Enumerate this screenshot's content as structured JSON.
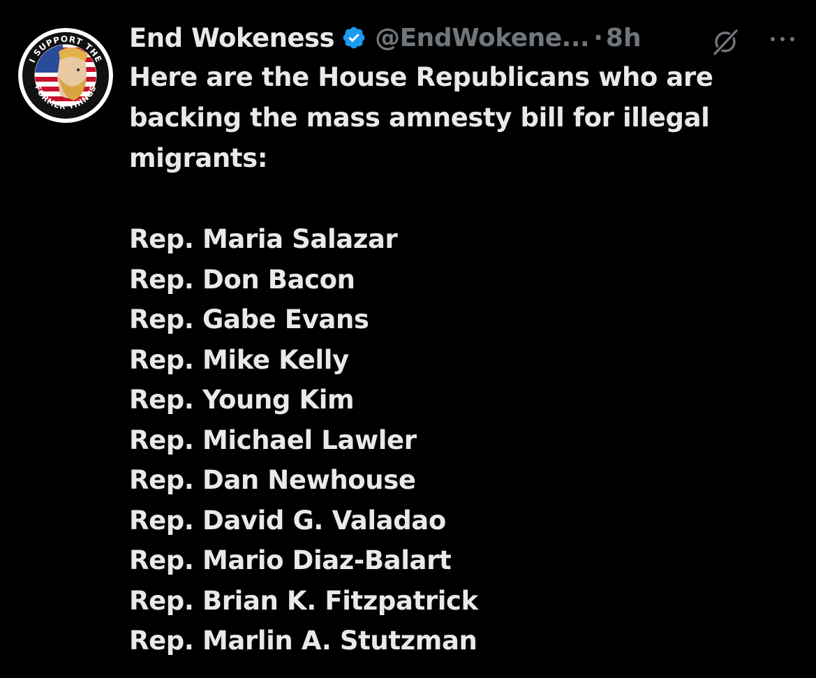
{
  "tweet": {
    "display_name": "End Wokeness",
    "handle": "@EndWokene...",
    "separator": "·",
    "time": "8h",
    "verified_icon": "verified-badge-icon",
    "grok_icon": "grok-icon",
    "more_icon": "more-options-icon",
    "avatar": {
      "top_text": "I SUPPORT THE",
      "bottom_text": "FORMER THINGS"
    },
    "intro": "Here are the House Republicans who are backing the mass amnesty bill for illegal migrants:",
    "reps": [
      "Rep. Maria Salazar",
      "Rep. Don Bacon",
      "Rep. Gabe Evans",
      "Rep. Mike Kelly",
      "Rep. Young Kim",
      "Rep. Michael Lawler",
      "Rep. Dan Newhouse",
      "Rep. David G. Valadao",
      "Rep. Mario Diaz-Balart",
      "Rep. Brian K. Fitzpatrick",
      "Rep. Marlin A. Stutzman"
    ]
  },
  "colors": {
    "background": "#000000",
    "text_primary": "#e7e9ea",
    "text_secondary": "#71767b",
    "verified_blue": "#1d9bf0"
  }
}
